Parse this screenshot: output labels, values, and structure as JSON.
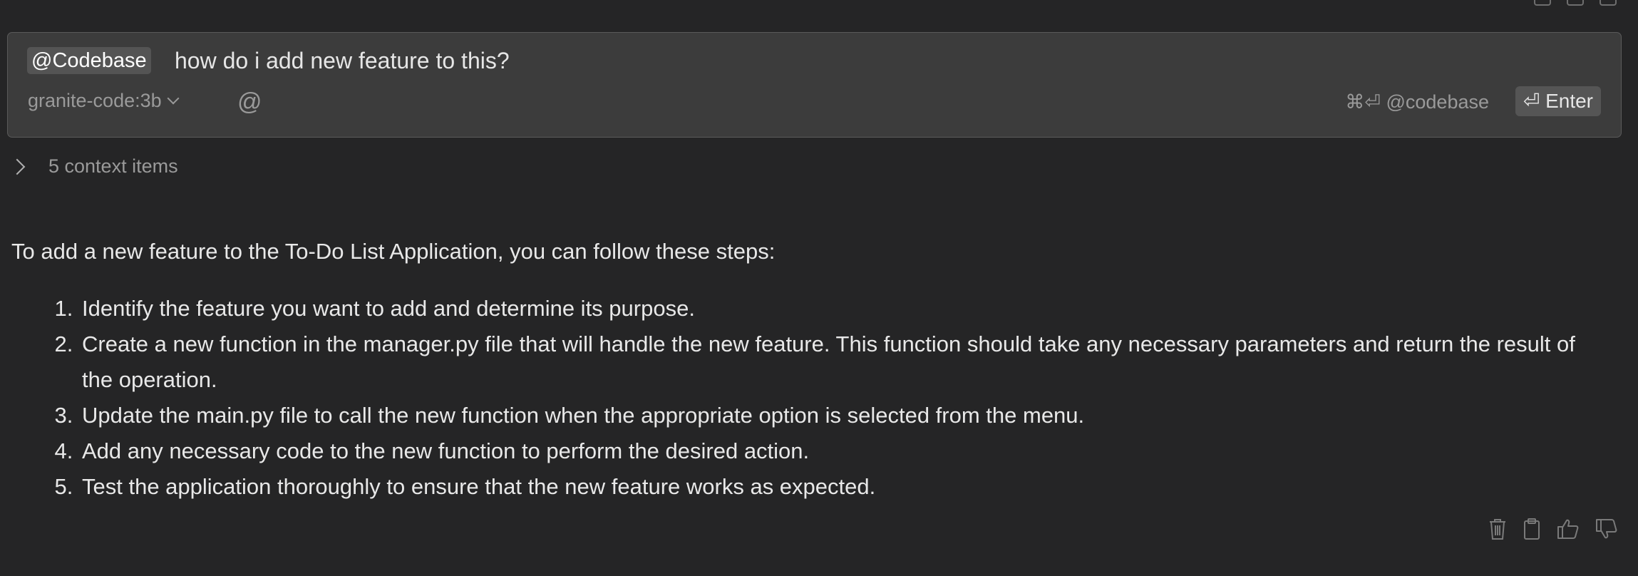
{
  "input": {
    "mention": "@Codebase",
    "query": "how do i add new feature to this?",
    "model": "granite-code:3b",
    "at_symbol": "@",
    "codebase_shortcut": "⌘⏎ @codebase",
    "enter_label": "⏎ Enter"
  },
  "context": {
    "label": "5 context items"
  },
  "response": {
    "intro": "To add a new feature to the To-Do List Application, you can follow these steps:",
    "steps": [
      "Identify the feature you want to add and determine its purpose.",
      "Create a new function in the manager.py file that will handle the new feature. This function should take any necessary parameters and return the result of the operation.",
      "Update the main.py file to call the new function when the appropriate option is selected from the menu.",
      "Add any necessary code to the new function to perform the desired action.",
      "Test the application thoroughly to ensure that the new feature works as expected."
    ]
  },
  "actions": {
    "icons": [
      "trash-icon",
      "clipboard-icon",
      "thumbs-up-icon",
      "thumbs-down-icon"
    ]
  }
}
